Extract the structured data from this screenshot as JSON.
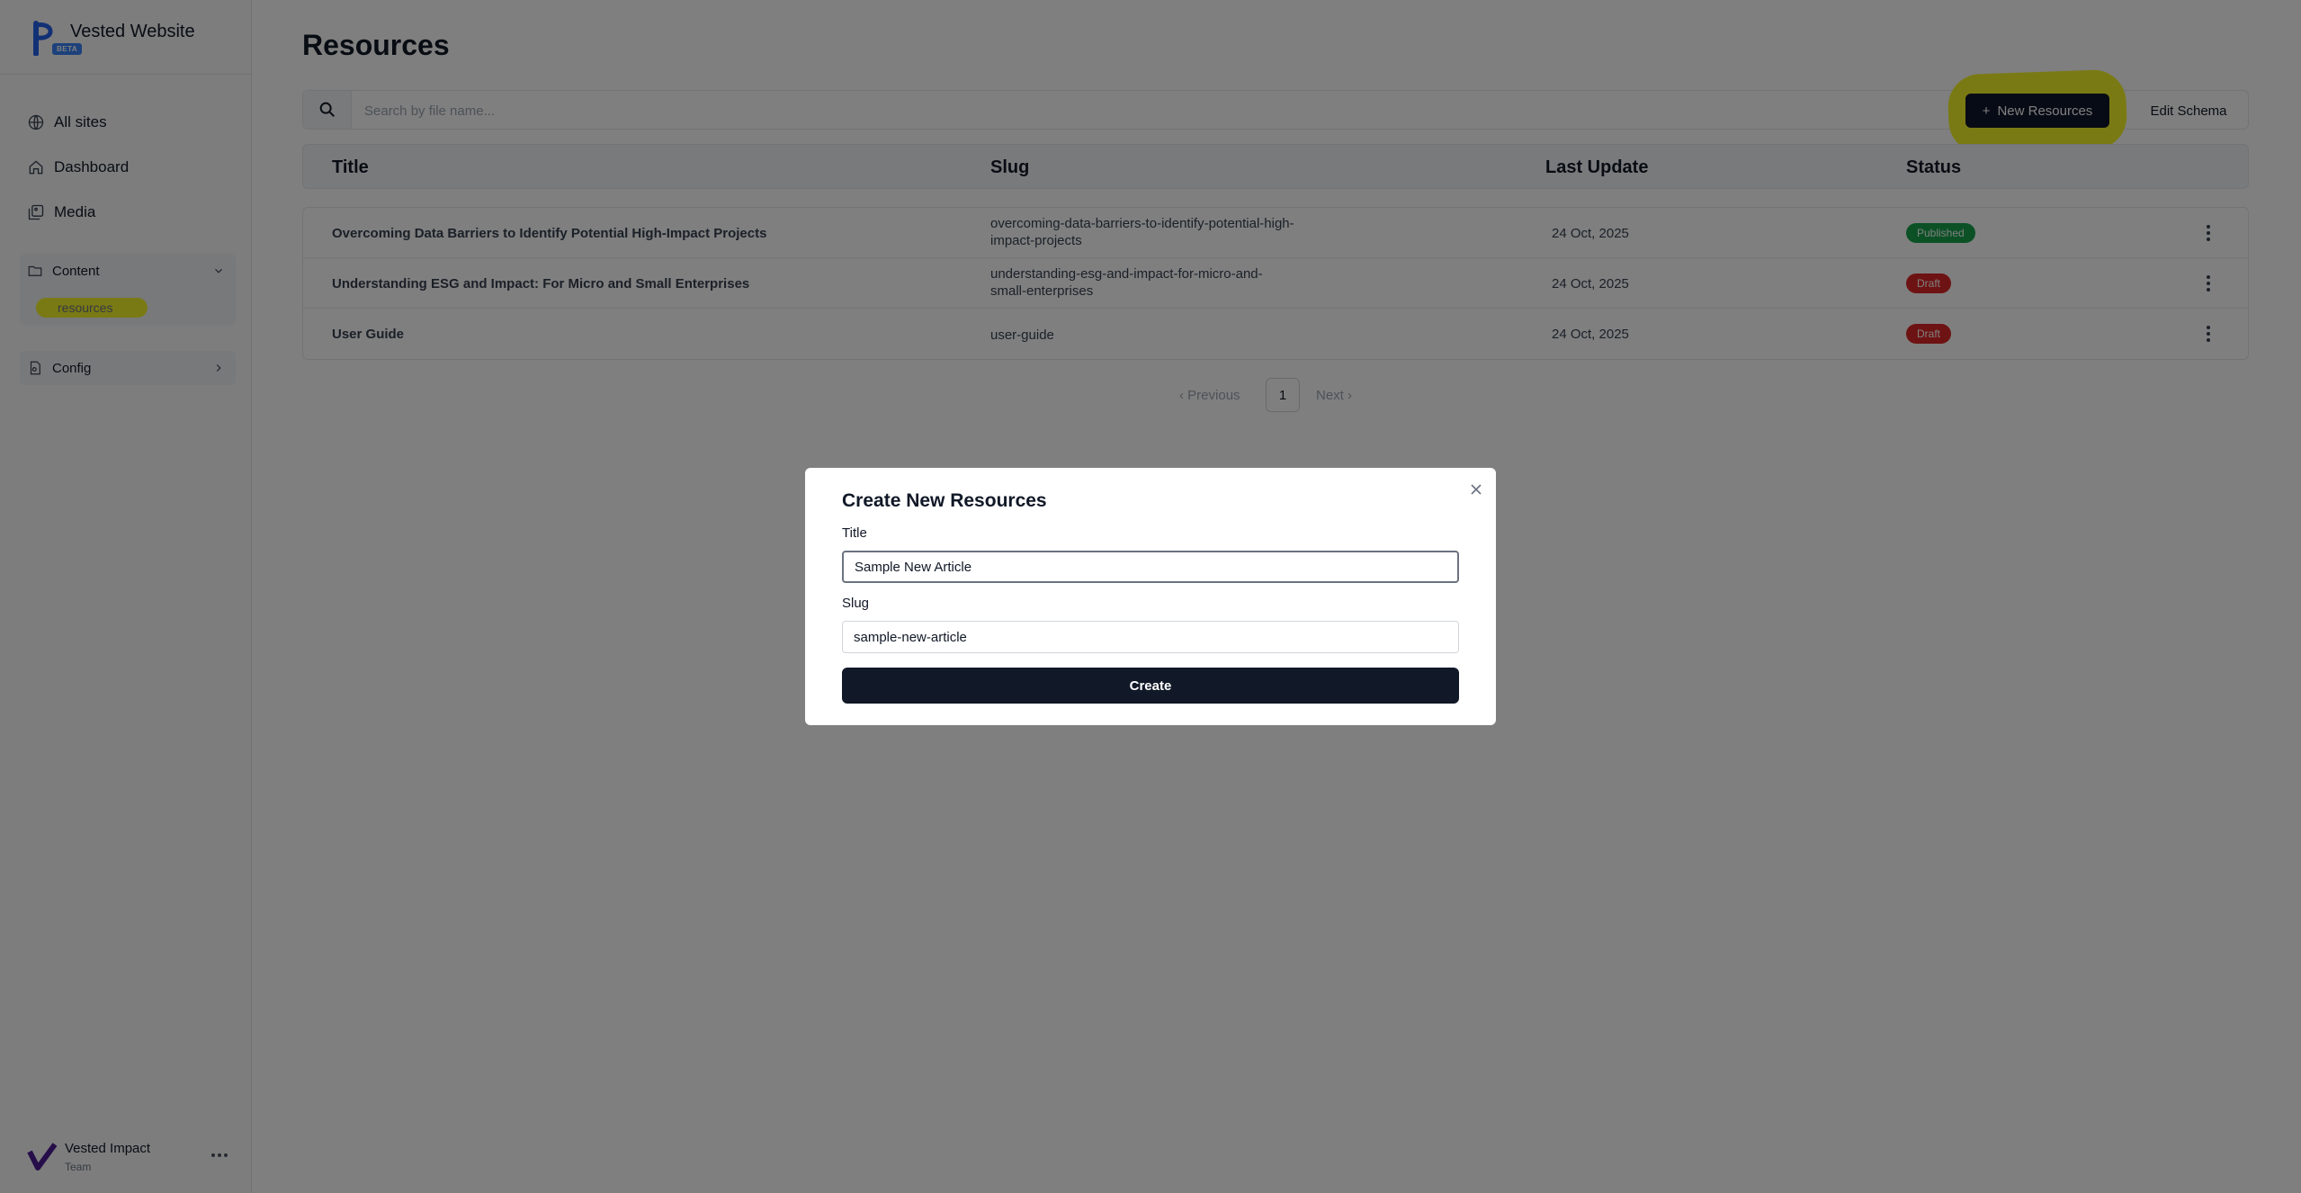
{
  "sidebar": {
    "brand_name": "Vested Website",
    "beta_label": "BETA",
    "nav": {
      "all_sites": "All sites",
      "dashboard": "Dashboard",
      "media": "Media"
    },
    "content_group": {
      "label": "Content",
      "items": [
        "resources"
      ]
    },
    "config_group": {
      "label": "Config"
    },
    "user": {
      "name": "Vested Impact",
      "role": "Team"
    }
  },
  "main": {
    "title": "Resources",
    "search": {
      "placeholder": "Search by file name...",
      "value": ""
    },
    "new_button": "New Resources",
    "edit_schema_button": "Edit Schema",
    "columns": [
      "Title",
      "Slug",
      "Last Update",
      "Status"
    ],
    "rows": [
      {
        "title": "Overcoming Data Barriers to Identify Potential High-Impact Projects",
        "slug": "overcoming-data-barriers-to-identify-potential-high-impact-projects",
        "last_update": "24 Oct, 2025",
        "status": "Published"
      },
      {
        "title": "Understanding ESG and Impact: For Micro and Small Enterprises",
        "slug": "understanding-esg-and-impact-for-micro-and-small-enterprises",
        "last_update": "24 Oct, 2025",
        "status": "Draft"
      },
      {
        "title": "User Guide",
        "slug": "user-guide",
        "last_update": "24 Oct, 2025",
        "status": "Draft"
      }
    ],
    "pagination": {
      "previous": "Previous",
      "current": "1",
      "next": "Next"
    }
  },
  "modal": {
    "title": "Create New Resources",
    "title_label": "Title",
    "title_value": "Sample New Article",
    "slug_label": "Slug",
    "slug_value": "sample-new-article",
    "create_button": "Create"
  },
  "colors": {
    "primary": "#0f172a",
    "published": "#16a34a",
    "draft": "#dc2626",
    "highlight": "#f5f52a",
    "overlay": "rgba(0,0,0,0.5)"
  },
  "icons": [
    "globe-icon",
    "home-icon",
    "media-icon",
    "folder-icon",
    "chevron-down-icon",
    "config-icon",
    "chevron-right-icon",
    "search-icon",
    "plus-icon",
    "kebab-icon",
    "close-icon",
    "more-icon"
  ]
}
